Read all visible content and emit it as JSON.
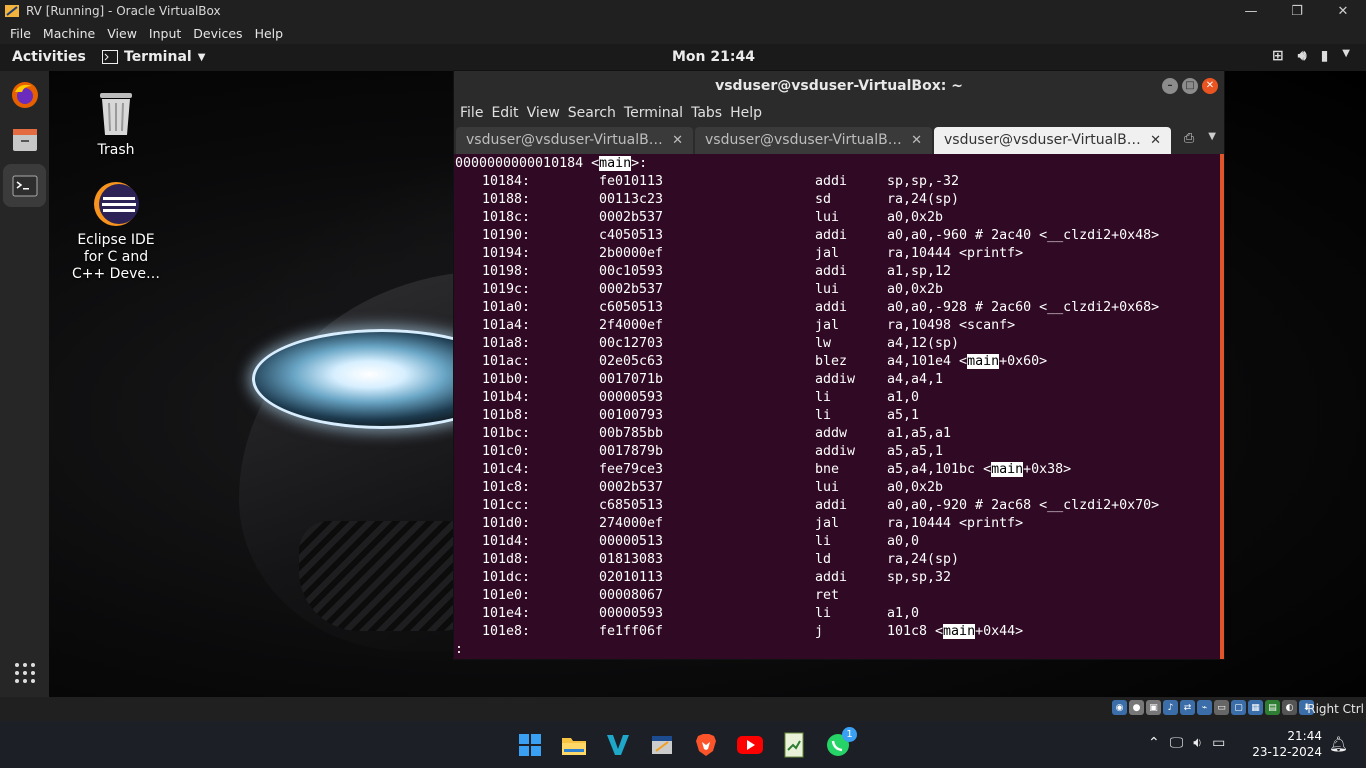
{
  "vbox": {
    "title": "RV [Running] - Oracle VirtualBox",
    "menu": [
      "File",
      "Machine",
      "View",
      "Input",
      "Devices",
      "Help"
    ],
    "status_key": "Right Ctrl"
  },
  "gnome": {
    "activities": "Activities",
    "app_name": "Terminal",
    "clock": "Mon 21:44"
  },
  "desktop": {
    "trash_label": "Trash",
    "eclipse_label": "Eclipse IDE for C and C++ Deve…"
  },
  "terminal": {
    "title": "vsduser@vsduser-VirtualBox: ~",
    "menu": [
      "File",
      "Edit",
      "View",
      "Search",
      "Terminal",
      "Tabs",
      "Help"
    ],
    "tabs": [
      "vsduser@vsduser-VirtualB…",
      "vsduser@vsduser-VirtualB…",
      "vsduser@vsduser-VirtualB…"
    ],
    "header": "0000000000010184 <main>:",
    "lines": [
      {
        "addr": "10184:",
        "hex": "fe010113",
        "op": "addi",
        "args": "sp,sp,-32"
      },
      {
        "addr": "10188:",
        "hex": "00113c23",
        "op": "sd",
        "args": "ra,24(sp)"
      },
      {
        "addr": "1018c:",
        "hex": "0002b537",
        "op": "lui",
        "args": "a0,0x2b"
      },
      {
        "addr": "10190:",
        "hex": "c4050513",
        "op": "addi",
        "args": "a0,a0,-960 # 2ac40 <__clzdi2+0x48>"
      },
      {
        "addr": "10194:",
        "hex": "2b0000ef",
        "op": "jal",
        "args": "ra,10444 <printf>"
      },
      {
        "addr": "10198:",
        "hex": "00c10593",
        "op": "addi",
        "args": "a1,sp,12"
      },
      {
        "addr": "1019c:",
        "hex": "0002b537",
        "op": "lui",
        "args": "a0,0x2b"
      },
      {
        "addr": "101a0:",
        "hex": "c6050513",
        "op": "addi",
        "args": "a0,a0,-928 # 2ac60 <__clzdi2+0x68>"
      },
      {
        "addr": "101a4:",
        "hex": "2f4000ef",
        "op": "jal",
        "args": "ra,10498 <scanf>"
      },
      {
        "addr": "101a8:",
        "hex": "00c12703",
        "op": "lw",
        "args": "a4,12(sp)"
      },
      {
        "addr": "101ac:",
        "hex": "02e05c63",
        "op": "blez",
        "args": "a4,101e4 <main+0x60>"
      },
      {
        "addr": "101b0:",
        "hex": "0017071b",
        "op": "addiw",
        "args": "a4,a4,1"
      },
      {
        "addr": "101b4:",
        "hex": "00000593",
        "op": "li",
        "args": "a1,0"
      },
      {
        "addr": "101b8:",
        "hex": "00100793",
        "op": "li",
        "args": "a5,1"
      },
      {
        "addr": "101bc:",
        "hex": "00b785bb",
        "op": "addw",
        "args": "a1,a5,a1"
      },
      {
        "addr": "101c0:",
        "hex": "0017879b",
        "op": "addiw",
        "args": "a5,a5,1"
      },
      {
        "addr": "101c4:",
        "hex": "fee79ce3",
        "op": "bne",
        "args": "a5,a4,101bc <main+0x38>"
      },
      {
        "addr": "101c8:",
        "hex": "0002b537",
        "op": "lui",
        "args": "a0,0x2b"
      },
      {
        "addr": "101cc:",
        "hex": "c6850513",
        "op": "addi",
        "args": "a0,a0,-920 # 2ac68 <__clzdi2+0x70>"
      },
      {
        "addr": "101d0:",
        "hex": "274000ef",
        "op": "jal",
        "args": "ra,10444 <printf>"
      },
      {
        "addr": "101d4:",
        "hex": "00000513",
        "op": "li",
        "args": "a0,0"
      },
      {
        "addr": "101d8:",
        "hex": "01813083",
        "op": "ld",
        "args": "ra,24(sp)"
      },
      {
        "addr": "101dc:",
        "hex": "02010113",
        "op": "addi",
        "args": "sp,sp,32"
      },
      {
        "addr": "101e0:",
        "hex": "00008067",
        "op": "ret",
        "args": ""
      },
      {
        "addr": "101e4:",
        "hex": "00000593",
        "op": "li",
        "args": "a1,0"
      },
      {
        "addr": "101e8:",
        "hex": "fe1ff06f",
        "op": "j",
        "args": "101c8 <main+0x44>"
      }
    ],
    "prompt": ":",
    "highlight": "main"
  },
  "taskbar": {
    "time": "21:44",
    "date": "23-12-2024",
    "whatsapp_badge": "1"
  }
}
